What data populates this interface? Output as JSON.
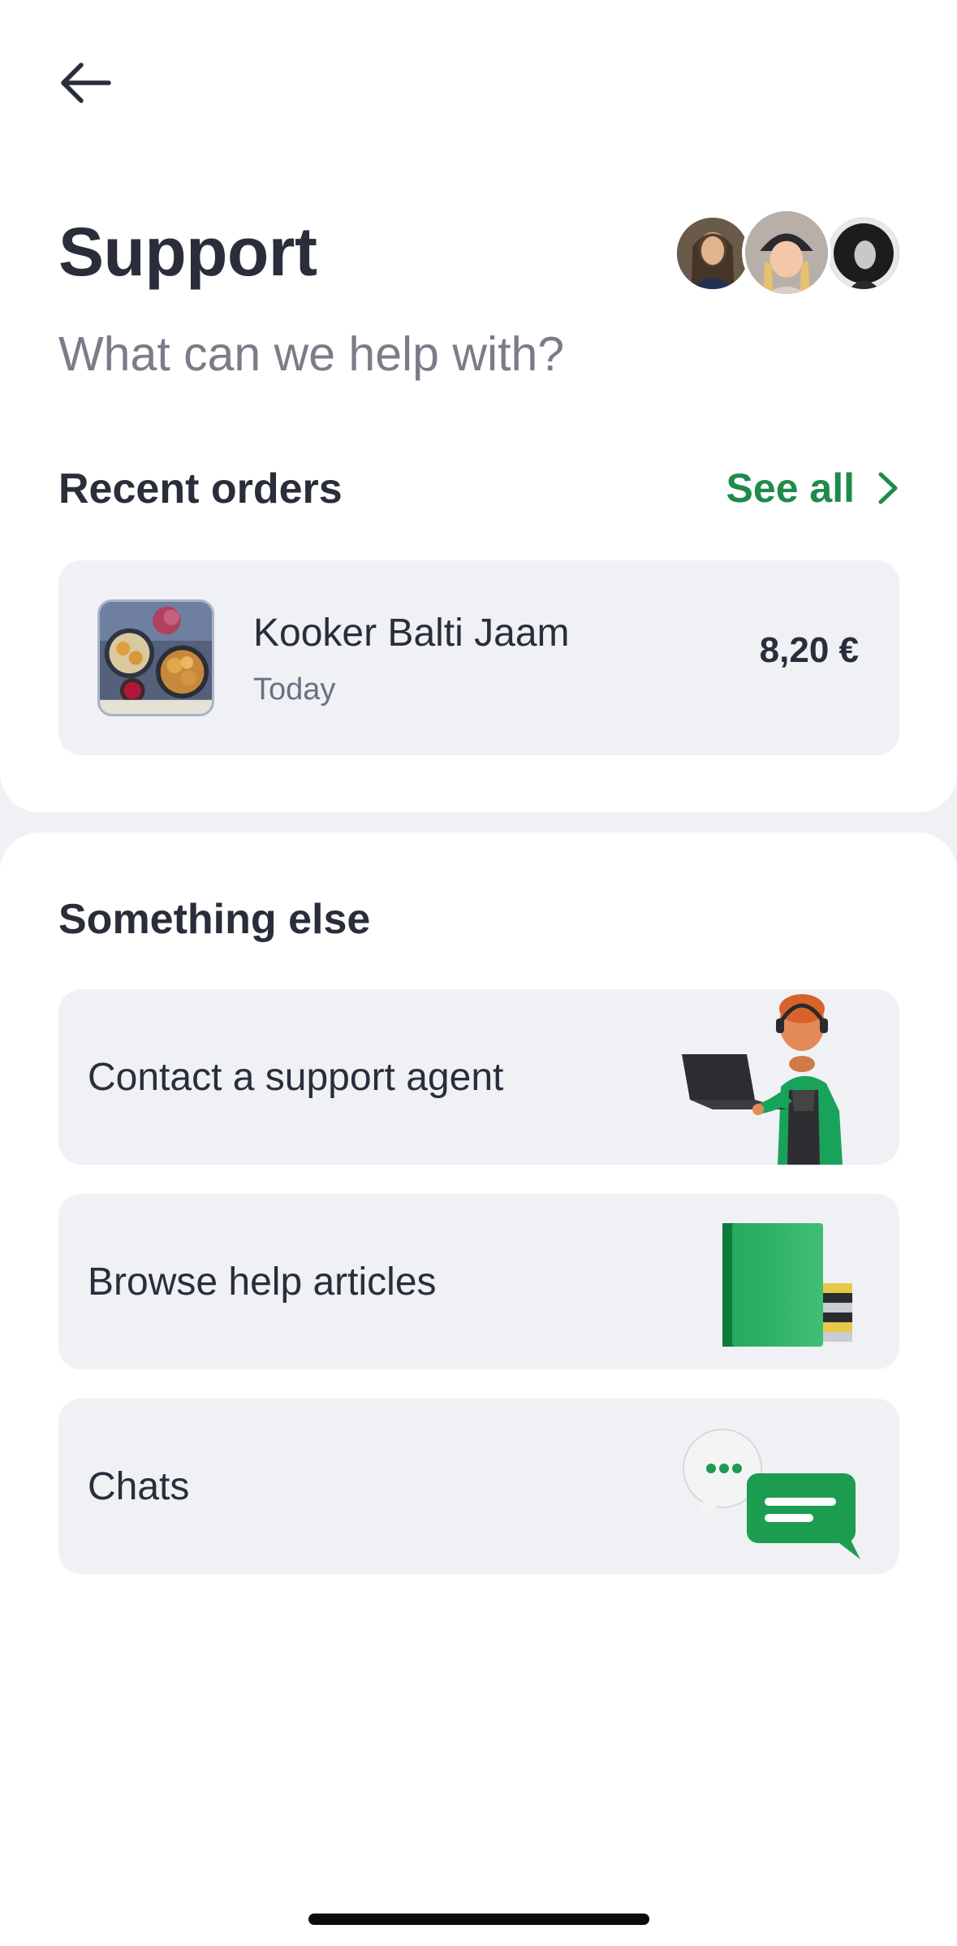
{
  "header": {
    "back_icon": "arrow-left-icon",
    "title": "Support",
    "subtitle": "What can we help with?",
    "avatars": [
      "support-agent-avatar",
      "support-agent-avatar",
      "support-agent-avatar"
    ]
  },
  "recent_orders": {
    "title": "Recent orders",
    "see_all_label": "See all",
    "see_all_icon": "chevron-right-icon",
    "orders": [
      {
        "name": "Kooker Balti Jaam",
        "date": "Today",
        "price": "8,20 €"
      }
    ]
  },
  "something_else": {
    "title": "Something else",
    "options": [
      {
        "label": "Contact a support agent",
        "icon": "support-agent-illustration"
      },
      {
        "label": "Browse help articles",
        "icon": "books-illustration"
      },
      {
        "label": "Chats",
        "icon": "chat-bubbles-illustration"
      }
    ]
  },
  "colors": {
    "accent": "#1f8a4c",
    "text": "#2a2d3a",
    "muted": "#7a7d87",
    "card": "#f0f1f5",
    "background": "#ffffff"
  }
}
